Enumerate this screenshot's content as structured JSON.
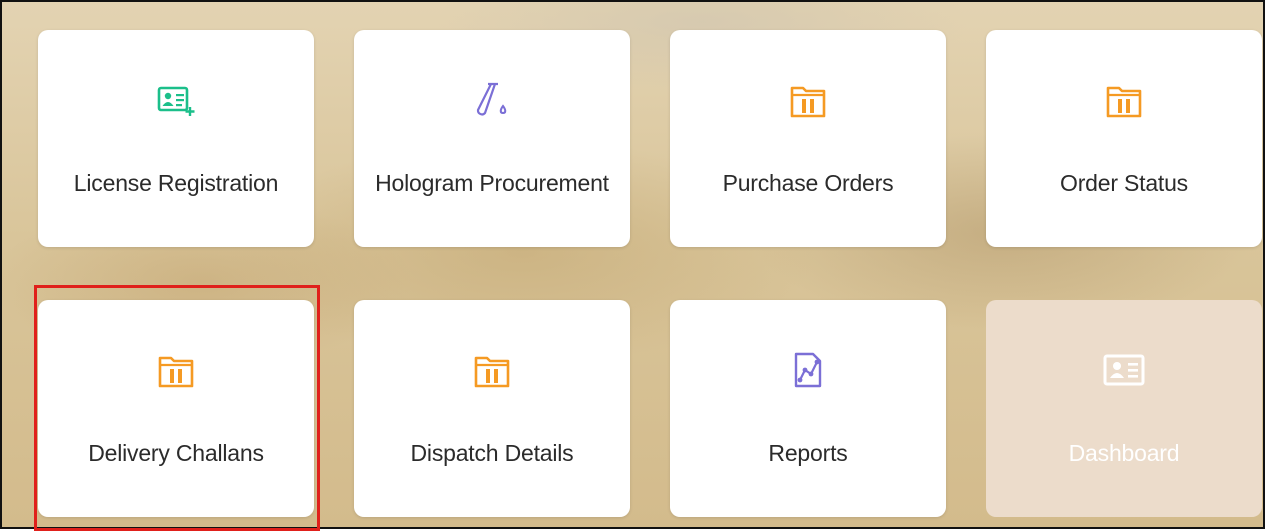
{
  "tiles": [
    {
      "label": "License Registration",
      "icon": "id-card-add-icon",
      "color": "#1bbf8a"
    },
    {
      "label": "Hologram Procurement",
      "icon": "test-tube-icon",
      "color": "#7b6fd6"
    },
    {
      "label": "Purchase Orders",
      "icon": "folder-icon",
      "color": "#f59a23"
    },
    {
      "label": "Order Status",
      "icon": "folder-icon",
      "color": "#f59a23"
    },
    {
      "label": "Delivery Challans",
      "icon": "folder-icon",
      "color": "#f59a23",
      "highlighted": true
    },
    {
      "label": "Dispatch Details",
      "icon": "folder-icon",
      "color": "#f59a23"
    },
    {
      "label": "Reports",
      "icon": "report-chart-icon",
      "color": "#7b6fd6"
    },
    {
      "label": "Dashboard",
      "icon": "id-card-icon",
      "color": "#ffffff",
      "disabled": true
    }
  ]
}
